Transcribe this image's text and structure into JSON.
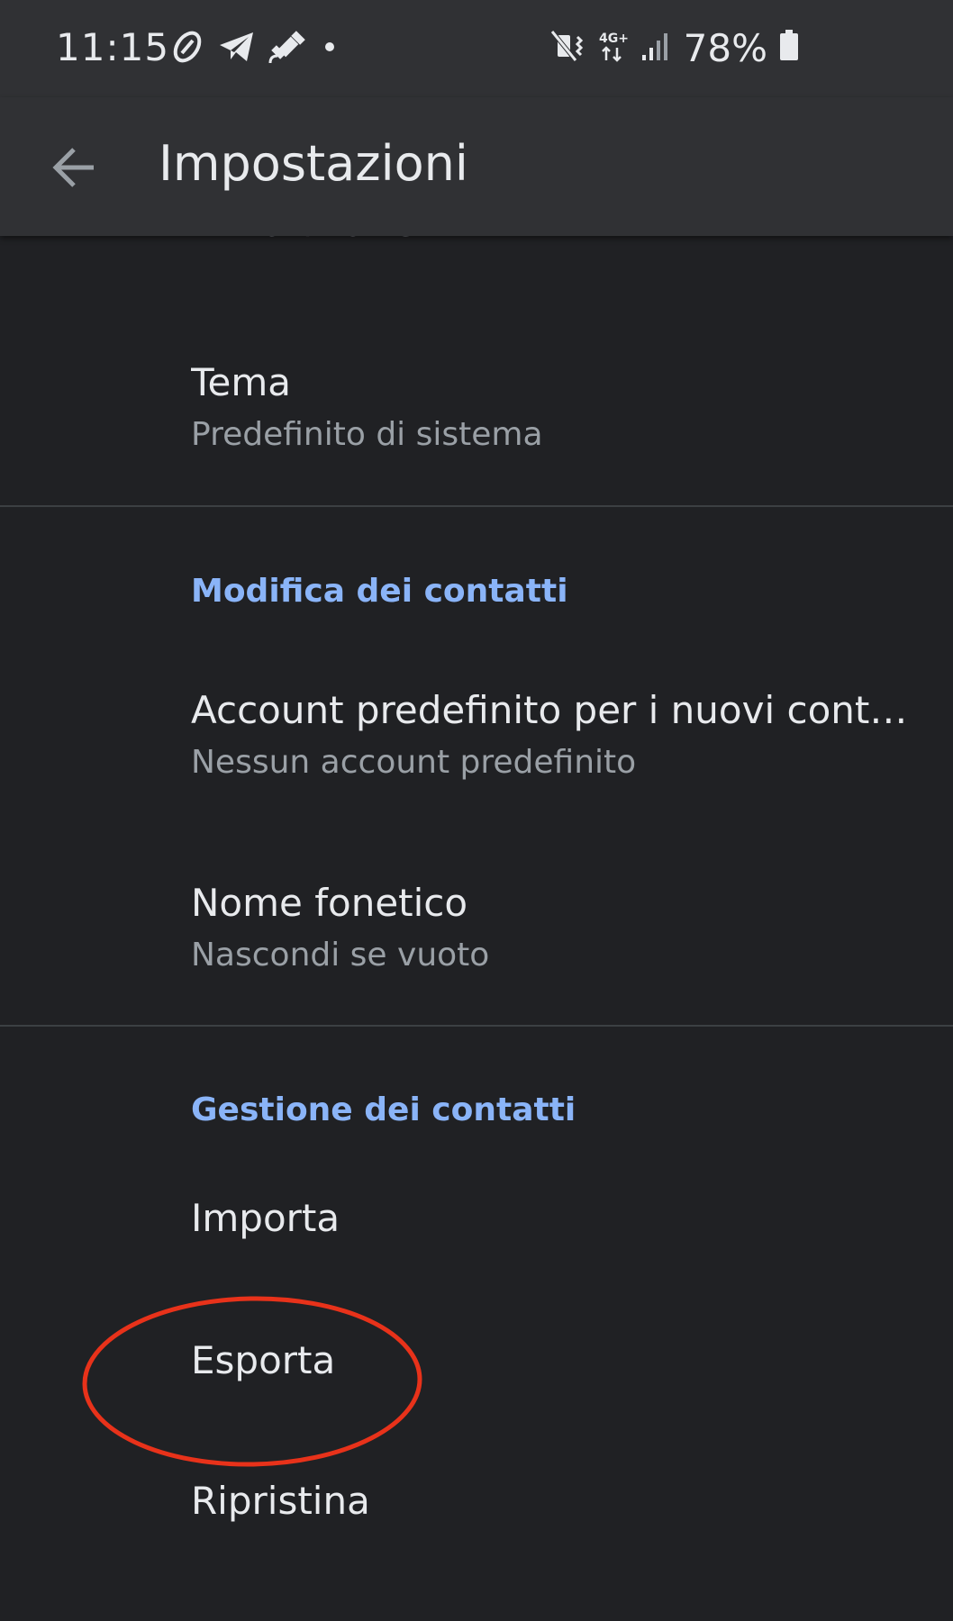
{
  "status_bar": {
    "time": "11:15",
    "battery": "78%",
    "network": "4G+",
    "icons_left": [
      "link-icon",
      "telegram-icon",
      "satellite-icon",
      "dot-icon"
    ],
    "icons_right": [
      "mute-vibrate-icon",
      "network-4g-icon",
      "signal-icon",
      "battery-icon"
    ]
  },
  "app_bar": {
    "title": "Impostazioni",
    "back_icon": "arrow-back-icon"
  },
  "settings": {
    "partial_summary": "Prima il nome",
    "tema": {
      "title": "Tema",
      "summary": "Predefinito di sistema"
    },
    "section_edit": "Modifica dei contatti",
    "default_account": {
      "title": "Account predefinito per i nuovi conta..",
      "summary": "Nessun account predefinito"
    },
    "phonetic_name": {
      "title": "Nome fonetico",
      "summary": "Nascondi se vuoto"
    },
    "section_manage": "Gestione dei contatti",
    "import": {
      "title": "Importa"
    },
    "export": {
      "title": "Esporta"
    },
    "restore": {
      "title": "Ripristina"
    }
  },
  "colors": {
    "background": "#202124",
    "app_bar": "#303134",
    "accent": "#8ab4f8",
    "annotation": "#e8321a"
  }
}
